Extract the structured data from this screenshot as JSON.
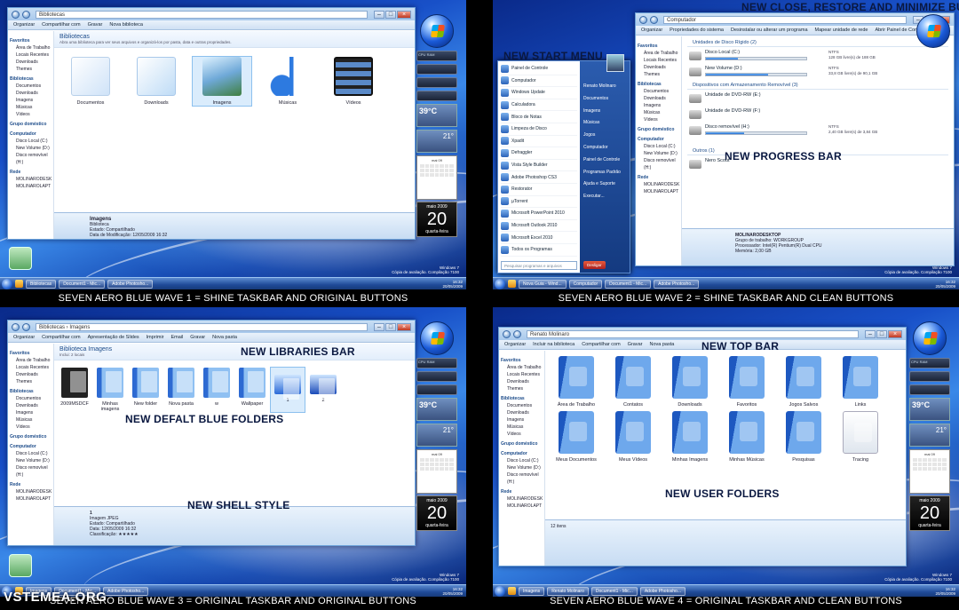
{
  "annotations": {
    "close_restore_minimize": "NEW CLOSE, RESTORE AND MINIMIZE BUTTONS",
    "start_menu": "NEW START MENU",
    "progress_bar": "NEW PROGRESS BAR",
    "libraries_bar": "NEW LIBRARIES BAR",
    "default_folders": "NEW DEFALT BLUE FOLDERS",
    "shell_style": "NEW SHELL STYLE",
    "top_bar": "NEW TOP BAR",
    "user_folders": "NEW USER FOLDERS"
  },
  "captions": {
    "wave1": "SEVEN AERO BLUE WAVE 1 = SHINE TASKBAR AND ORIGINAL BUTTONS",
    "wave2": "SEVEN AERO BLUE WAVE 2 = SHINE TASKBAR AND CLEAN BUTTONS",
    "wave3": "SEVEN AERO BLUE WAVE 3 = ORIGINAL TASKBAR AND ORIGINAL BUTTONS",
    "wave4": "SEVEN AERO BLUE WAVE 4 = ORIGINAL TASKBAR AND CLEAN BUTTONS"
  },
  "watermark": "VSTEMEA.ORG",
  "nav": {
    "favoritos": "Favoritos",
    "area": "Área de Trabalho",
    "locais": "Locais Recentes",
    "downloads": "Downloads",
    "themes": "Themes",
    "bibliotecas": "Bibliotecas",
    "documentos": "Documentos",
    "downloads2": "Downloads",
    "imagens": "Imagens",
    "musicas": "Músicas",
    "videos": "Vídeos",
    "grupo": "Grupo doméstico",
    "computador": "Computador",
    "disco_c": "Disco Local (C:)",
    "new_volume": "New Volume (D:)",
    "disco_rem": "Disco removível (H:)",
    "rede": "Rede",
    "rede1": "MOLINARODESK",
    "rede2": "MOLINAROLAPT"
  },
  "q1": {
    "address": "Bibliotecas",
    "toolbar": [
      "Organizar",
      "Compartilhar com",
      "Gravar",
      "Nova biblioteca"
    ],
    "heading": "Bibliotecas",
    "subheading": "Abra uma biblioteca para ver seus arquivos e organizá-los por pasta, data e outras propriedades.",
    "items": [
      "Documentos",
      "Downloads",
      "Imagens",
      "Músicas",
      "Vídeos"
    ],
    "detail_name": "Imagens",
    "detail_lines": [
      "Biblioteca",
      "Estado: Compartilhado",
      "Data de Modificação: 12/05/2009 16:32",
      "Compartilhado com: Grupo doméstico"
    ]
  },
  "q2": {
    "address": "Computador",
    "toolbar": [
      "Organizar",
      "Propriedades do sistema",
      "Desinstalar ou alterar um programa",
      "Mapear unidade de rede",
      "Abrir Painel de Controle"
    ],
    "sect_hdd": "Unidades de Disco Rígido (2)",
    "drives": [
      {
        "name": "Disco Local (C:)",
        "fs": "NTFS",
        "free": "128 GB livre(s) de 188 GB",
        "used": 0.32
      },
      {
        "name": "New Volume (D:)",
        "fs": "NTFS",
        "free": "33,8 GB livre(s) de 90,1 GB",
        "used": 0.62
      }
    ],
    "sect_rem": "Dispositivos com Armazenamento Removível (3)",
    "rem": [
      "Unidade de DVD-RW (E:)",
      "Unidade de DVD-RW (F:)"
    ],
    "removable": {
      "name": "Disco removível (H:)",
      "fs": "NTFS",
      "free": "2,40 GB livre(s) de 3,84 GB",
      "used": 0.38
    },
    "sect_other": "Outros (1)",
    "other": "Nero Scout",
    "pc_name": "MOLINARODESKTOP",
    "pc_info": [
      "Grupo de trabalho: WORKGROUP",
      "Processador: Intel(R) Pentium(R) Dual CPU",
      "Memória: 2,00 GB"
    ]
  },
  "start_menu": {
    "left": [
      "Painel de Controle",
      "Computador",
      "Windows Update",
      "Calculadora",
      "Bloco de Notas",
      "Limpeza de Disco",
      "Xpadit",
      "Defraggler",
      "Vista Style Builder",
      "Adobe Photoshop CS3",
      "Restorator",
      "µTorrent",
      "Microsoft PowerPoint 2010",
      "Microsoft Outlook 2010",
      "Microsoft Excel 2010",
      "Todos os Programas"
    ],
    "search": "Pesquisar programas e arquivos",
    "right": [
      "Renato Molinaro",
      "Documentos",
      "Imagens",
      "Músicas",
      "Jogos",
      "Computador",
      "Painel de Controle",
      "Programas Padrão",
      "Ajuda e Suporte",
      "Executar..."
    ],
    "shutdown": "Desligar"
  },
  "q3": {
    "address": "Bibliotecas › Imagens",
    "toolbar": [
      "Organizar",
      "Compartilhar com",
      "Apresentação de Slides",
      "Imprimir",
      "Email",
      "Gravar",
      "Nova pasta"
    ],
    "heading": "Biblioteca Imagens",
    "subheading": "Inclui: 2 locais",
    "items": [
      "2009MSDCF",
      "Minhas imagens",
      "New folder",
      "Nova pasta",
      "w",
      "Wallpaper",
      "1",
      "2"
    ],
    "detail_lines": [
      "1",
      "Imagem JPEG",
      "Estado: Compartilhado",
      "Data: 12/05/2009 16:32",
      "Classificação: ★★★★★"
    ]
  },
  "q4": {
    "address": "Renato Molinaro",
    "toolbar": [
      "Organizar",
      "Incluir na biblioteca",
      "Compartilhar com",
      "Gravar",
      "Nova pasta"
    ],
    "items": [
      "Área de Trabalho",
      "Contatos",
      "Downloads",
      "Favoritos",
      "Jogos Salvos",
      "Links",
      "Meus Documentos",
      "Meus Vídeos",
      "Minhas Imagens",
      "Minhas Músicas",
      "Pesquisas",
      "Tracing"
    ],
    "status": "12 itens"
  },
  "gadgets": {
    "temp": "39°C",
    "temp2": "21°",
    "cal_month": "mai 09",
    "day_month": "maio 2009",
    "day_num": "20",
    "day_week": "quarta-feira",
    "cpu": "CPU",
    "ram": "RAM"
  },
  "taskbar": {
    "q1": [
      "Bibliotecas",
      "Document1 - Mic...",
      "Adobe Photosho..."
    ],
    "q2": [
      "Nova Guia - Wind...",
      "Computador",
      "Document1 - Mic...",
      "Adobe Photosho..."
    ],
    "q3": [
      "Imagens",
      "Document1 - Mic...",
      "Adobe Photosho..."
    ],
    "q4": [
      "Imagens",
      "Renato Molinaro",
      "Document1 - Mic...",
      "Adobe Photosho..."
    ],
    "time": "16:32",
    "date": "20/05/2009"
  },
  "windows_mark": {
    "line1": "Windows 7",
    "line2": "Cópia de avaliação. Compilação 7100",
    "date": "20/05/2009"
  },
  "colors": {
    "accent": "#1e64c8",
    "taskbar": "#1f4a98",
    "background": "#000000"
  }
}
